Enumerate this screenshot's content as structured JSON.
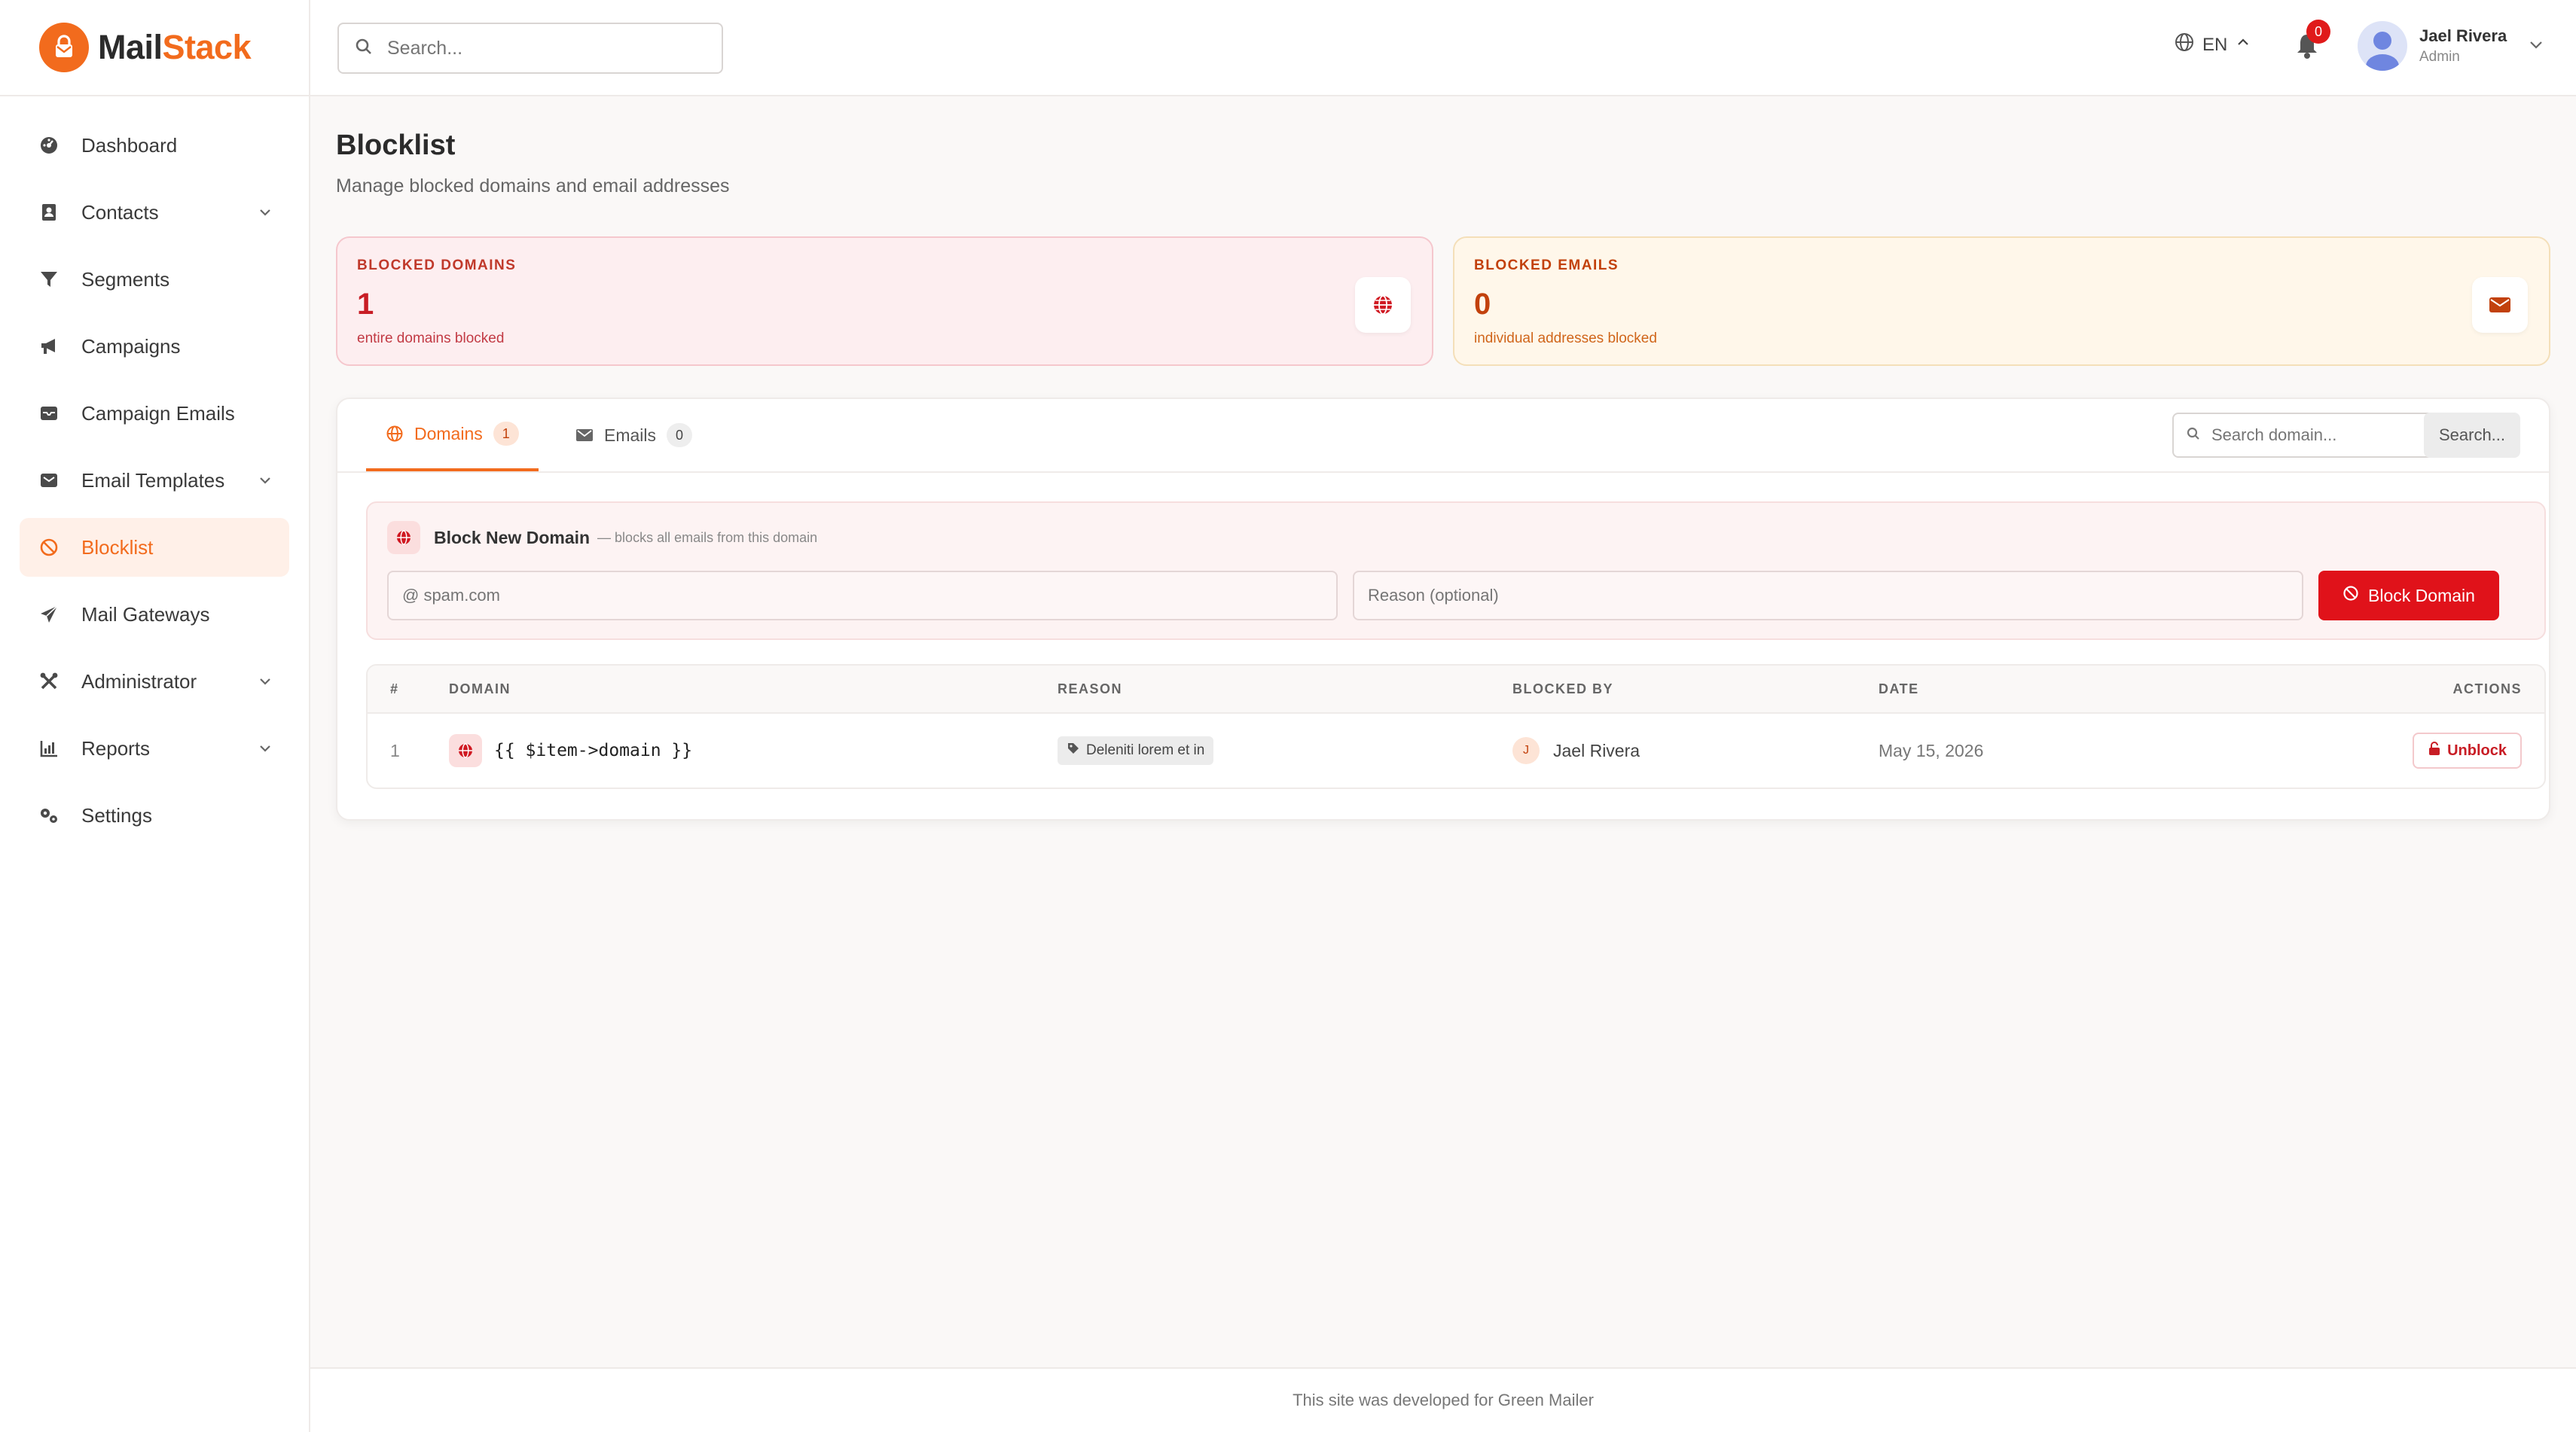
{
  "brand": {
    "name_part1": "Mail",
    "name_part2": "Stack",
    "accent": "#f26b1d"
  },
  "header": {
    "search_placeholder": "Search...",
    "language": "EN",
    "notifications_count": "0",
    "user": {
      "name": "Jael Rivera",
      "role": "Admin"
    }
  },
  "sidebar": {
    "items": [
      {
        "label": "Dashboard",
        "icon": "dashboard-icon",
        "has_children": false,
        "active": false
      },
      {
        "label": "Contacts",
        "icon": "contacts-icon",
        "has_children": true,
        "active": false
      },
      {
        "label": "Segments",
        "icon": "filter-icon",
        "has_children": false,
        "active": false
      },
      {
        "label": "Campaigns",
        "icon": "megaphone-icon",
        "has_children": false,
        "active": false
      },
      {
        "label": "Campaign Emails",
        "icon": "inbox-icon",
        "has_children": false,
        "active": false
      },
      {
        "label": "Email Templates",
        "icon": "template-icon",
        "has_children": true,
        "active": false
      },
      {
        "label": "Blocklist",
        "icon": "ban-icon",
        "has_children": false,
        "active": true
      },
      {
        "label": "Mail Gateways",
        "icon": "paper-plane-icon",
        "has_children": false,
        "active": false
      },
      {
        "label": "Administrator",
        "icon": "tools-icon",
        "has_children": true,
        "active": false
      },
      {
        "label": "Reports",
        "icon": "chart-icon",
        "has_children": true,
        "active": false
      },
      {
        "label": "Settings",
        "icon": "gears-icon",
        "has_children": false,
        "active": false
      }
    ]
  },
  "page": {
    "title": "Blocklist",
    "subtitle": "Manage blocked domains and email addresses"
  },
  "stats": {
    "domains": {
      "label": "BLOCKED DOMAINS",
      "value": "1",
      "desc": "entire domains blocked",
      "icon": "globe-icon",
      "color": "#c81d25"
    },
    "emails": {
      "label": "BLOCKED EMAILS",
      "value": "0",
      "desc": "individual addresses blocked",
      "icon": "envelope-icon",
      "color": "#c2410c"
    }
  },
  "tabs": {
    "domains": {
      "label": "Domains",
      "count": "1"
    },
    "emails": {
      "label": "Emails",
      "count": "0"
    },
    "search_placeholder": "Search domain...",
    "search_button": "Search..."
  },
  "block_form": {
    "title": "Block New Domain",
    "note": "— blocks all emails from this domain",
    "domain_placeholder": "@ spam.com",
    "reason_placeholder": "Reason (optional)",
    "button": "Block Domain"
  },
  "table": {
    "headers": {
      "num": "#",
      "domain": "DOMAIN",
      "reason": "REASON",
      "blocked_by": "BLOCKED BY",
      "date": "DATE",
      "actions": "ACTIONS"
    },
    "rows": [
      {
        "num": "1",
        "domain": "{{ $item->domain }}",
        "reason": "Deleniti lorem et in",
        "blocked_by_initial": "J",
        "blocked_by": "Jael Rivera",
        "date": "May 15, 2026",
        "action": "Unblock"
      }
    ]
  },
  "footer": {
    "text": "This site was developed for Green Mailer"
  }
}
